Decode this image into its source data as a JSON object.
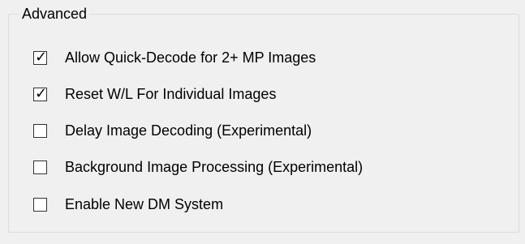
{
  "section": {
    "title": "Advanced"
  },
  "options": [
    {
      "label": "Allow Quick-Decode for 2+ MP Images",
      "checked": true
    },
    {
      "label": "Reset W/L For Individual Images",
      "checked": true
    },
    {
      "label": "Delay Image Decoding (Experimental)",
      "checked": false
    },
    {
      "label": "Background Image Processing (Experimental)",
      "checked": false
    },
    {
      "label": "Enable New DM System",
      "checked": false
    }
  ],
  "icons": {
    "checkmark": "✓"
  }
}
